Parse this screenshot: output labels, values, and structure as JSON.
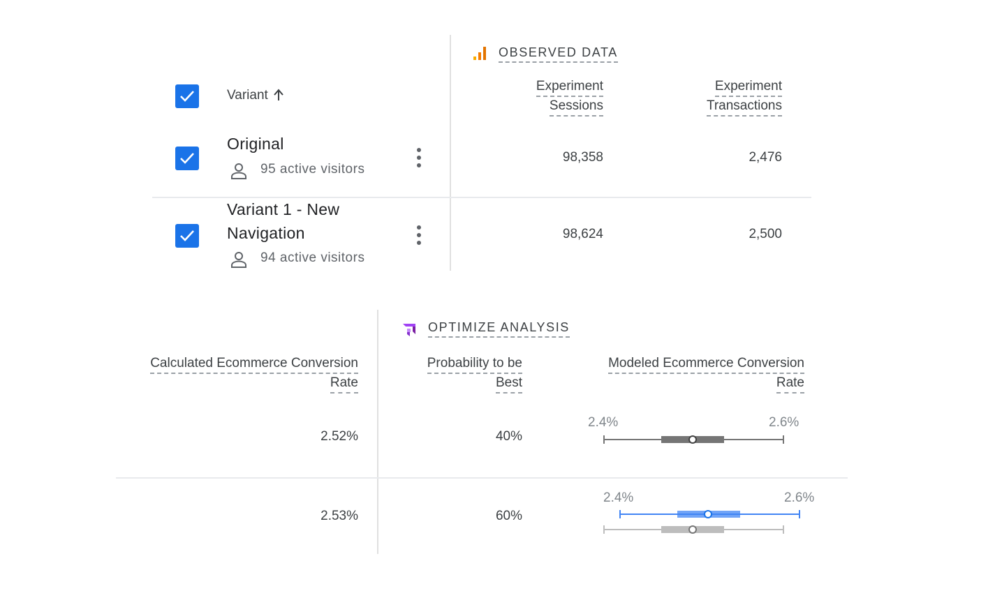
{
  "observed": {
    "title": "OBSERVED DATA",
    "icon": "analytics-bars-icon",
    "icon_color": "#f57c00",
    "variant_header": "Variant",
    "sort_icon": "arrow-up-icon",
    "sessions_header": [
      "Experiment",
      "Sessions"
    ],
    "transactions_header": [
      "Experiment",
      "Transactions"
    ]
  },
  "variants": [
    {
      "name_lines": [
        "Original"
      ],
      "visitors": "95 active visitors",
      "sessions": "98,358",
      "transactions": "2,476",
      "calc_rate": "2.52%",
      "prob_best": "40%",
      "range_min": "2.4%",
      "range_max": "2.6%"
    },
    {
      "name_lines": [
        "Variant 1 - New",
        "Navigation"
      ],
      "visitors": "94 active visitors",
      "sessions": "98,624",
      "transactions": "2,500",
      "calc_rate": "2.53%",
      "prob_best": "60%",
      "range_min": "2.4%",
      "range_max": "2.6%"
    }
  ],
  "optimize": {
    "title": "OPTIMIZE ANALYSIS",
    "icon": "optimize-logo-icon",
    "icon_color": "#a142f4",
    "calc_header": [
      "Calculated Ecommerce Conversion",
      "Rate"
    ],
    "prob_header": [
      "Probability to be",
      "Best"
    ],
    "modeled_header": [
      "Modeled Ecommerce Conversion",
      "Rate"
    ]
  },
  "colors": {
    "checkbox": "#1a73e8",
    "original_range": "#757575",
    "variant_range": "#4285f4",
    "baseline_range": "#bdbdbd"
  }
}
